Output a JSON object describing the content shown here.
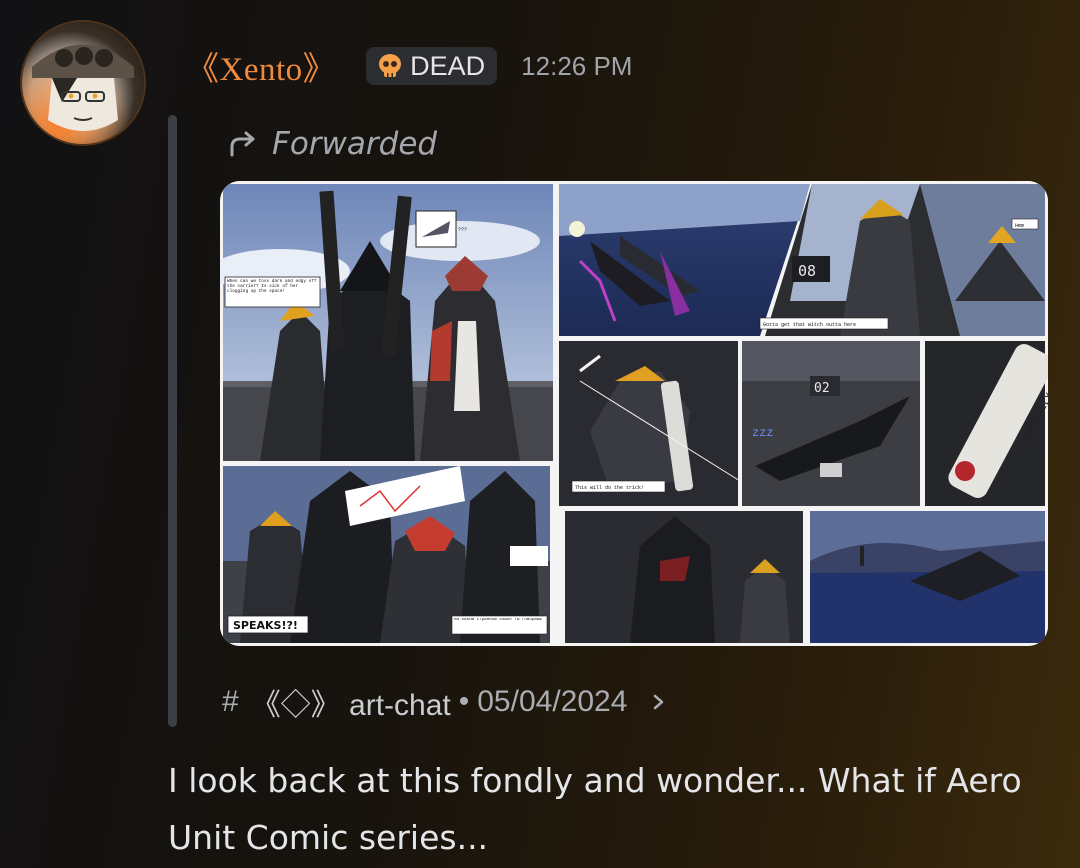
{
  "message": {
    "username": "《Xento》",
    "role_badge": {
      "label": "DEAD",
      "icon": "skull-icon"
    },
    "timestamp": "12:26 PM",
    "forwarded_label": "Forwarded",
    "attachment": {
      "kind": "comic-page-image",
      "panel_texts": {
        "caption_top_left": "When can we toss dark and edgy off the carrier? Is sick of her clogging up the space!",
        "thought_bubble": "???",
        "tail_code_1": "08",
        "caption_hmm": "Hmm",
        "caption_witch": "Gotta get that witch outta here",
        "tail_code_2": "02",
        "zzz": "zzz",
        "marker_label": "COMICALLY L",
        "caption_trick": "This will do the trick!",
        "speaks": "SPEAKS!?!",
        "caption_russian": "На каком странном языке ты говоришь"
      }
    },
    "source": {
      "hash": "#",
      "channel": "《◇》 art-chat",
      "separator": "•",
      "date": "05/04/2024"
    },
    "text": "I look back at this fondly and wonder... What if Aero Unit Comic series..."
  },
  "colors": {
    "username": "#f08a3c",
    "badge_bg": "#2b2d31",
    "forward_bar": "#3c3f45"
  }
}
